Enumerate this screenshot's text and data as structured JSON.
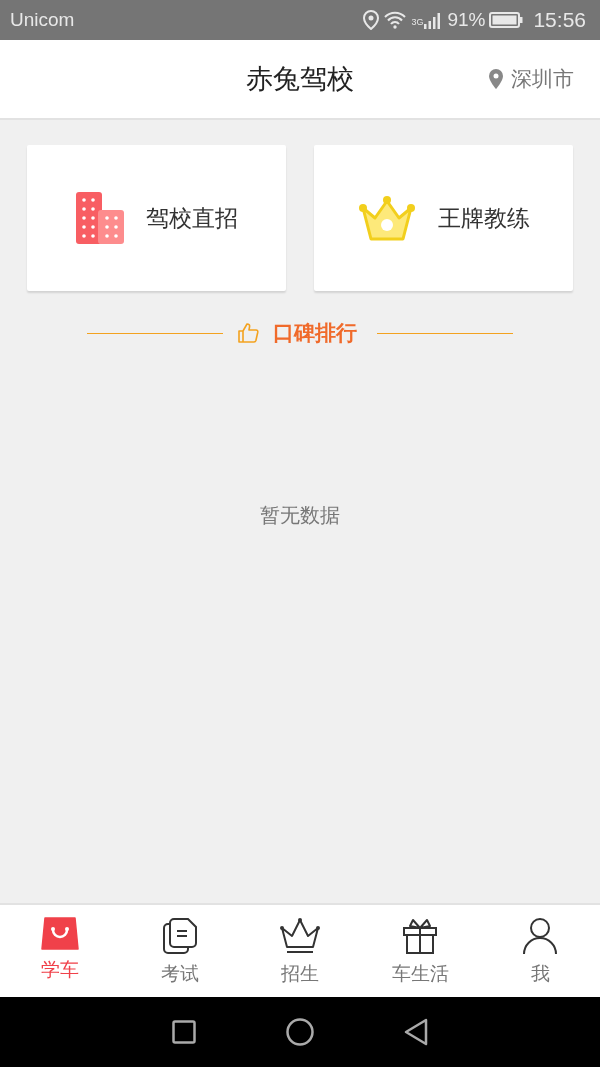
{
  "status_bar": {
    "carrier": "Unicom",
    "network": "3G",
    "battery": "91%",
    "time": "15:56"
  },
  "header": {
    "title": "赤兔驾校",
    "city": "深圳市"
  },
  "cards": [
    {
      "kind": "building",
      "label": "驾校直招"
    },
    {
      "kind": "crown",
      "label": "王牌教练"
    }
  ],
  "section": {
    "title": "口碑排行"
  },
  "empty_text": "暂无数据",
  "tabs": [
    {
      "kind": "bag",
      "label": "学车",
      "selected": true
    },
    {
      "kind": "document",
      "label": "考试",
      "selected": false
    },
    {
      "kind": "crown",
      "label": "招生",
      "selected": false
    },
    {
      "kind": "gift",
      "label": "车生活",
      "selected": false
    },
    {
      "kind": "person",
      "label": "我",
      "selected": false
    }
  ]
}
